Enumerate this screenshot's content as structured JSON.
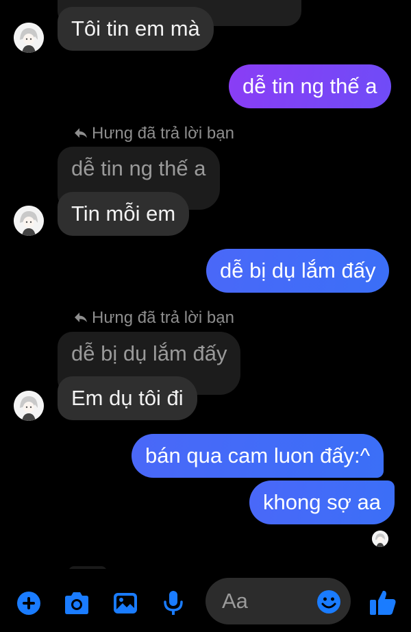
{
  "thread": {
    "messages": [
      {
        "id": "m1",
        "sender": "them",
        "text": "Tôi tin em mà"
      },
      {
        "id": "m2",
        "sender": "me",
        "text": "dễ tin ng thế a"
      },
      {
        "id": "m3",
        "sender": "them",
        "reply_label": "Hưng đã trả lời bạn",
        "quoted": "dễ tin ng thế a",
        "text": "Tin mỗi em"
      },
      {
        "id": "m4",
        "sender": "me",
        "text": "dễ bị dụ lắm đấy"
      },
      {
        "id": "m5",
        "sender": "them",
        "reply_label": "Hưng đã trả lời bạn",
        "quoted": "dễ bị dụ lắm đấy",
        "text": "Em dụ tôi đi"
      },
      {
        "id": "m6",
        "sender": "me",
        "text": "bán qua cam luon đấy:^"
      },
      {
        "id": "m7",
        "sender": "me",
        "text": "khong sợ aa"
      }
    ]
  },
  "composer": {
    "placeholder": "Aa",
    "tools": [
      "add-icon",
      "camera-icon",
      "gallery-icon",
      "microphone-icon"
    ],
    "emoji_icon": "emoji-icon",
    "send_icon": "thumbs-up-icon"
  },
  "colors": {
    "background": "#000000",
    "incoming_bubble": "#2f2f2f",
    "outgoing_purple": "#8a3df5",
    "outgoing_blue": "#3b6ff7",
    "accent": "#1a7cff"
  }
}
